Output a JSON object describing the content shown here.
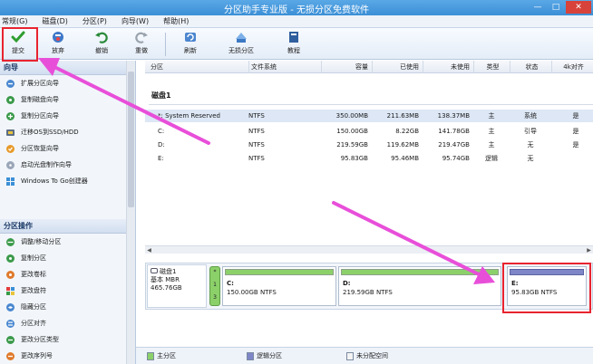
{
  "window": {
    "title": "分区助手专业版 - 无损分区免费软件",
    "controls": [
      "—",
      "□",
      "✕"
    ]
  },
  "menu": [
    "常规(G)",
    "磁盘(D)",
    "分区(P)",
    "向导(W)",
    "帮助(H)"
  ],
  "toolbar": {
    "submit": "提交",
    "discard": "放弃",
    "undo": "撤销",
    "redo": "重做",
    "refresh": "刷新",
    "lossless": "无损分区",
    "tutorial": "教程"
  },
  "left": {
    "wizard_header": "向导",
    "wizard_items": [
      "扩展分区向导",
      "复制磁盘向导",
      "复制分区向导",
      "迁移OS到SSD/HDD",
      "分区恢复向导",
      "启动光盘制作向导",
      "Windows To Go创建器"
    ],
    "ops_header": "分区操作",
    "ops_items": [
      "调整/移动分区",
      "复制分区",
      "更改卷标",
      "更改盘符",
      "隐藏分区",
      "分区对齐",
      "更改分区类型",
      "更改序列号"
    ]
  },
  "table": {
    "headers": [
      "分区",
      "文件系统",
      "容量",
      "已使用",
      "未使用",
      "类型",
      "状态",
      "4k对齐"
    ],
    "disk_title": "磁盘1",
    "rows": [
      {
        "name": "*: System Reserved",
        "fs": "NTFS",
        "cap": "350.00MB",
        "used": "211.63MB",
        "free": "138.37MB",
        "type": "主",
        "status": "系统",
        "align": "是"
      },
      {
        "name": "C:",
        "fs": "NTFS",
        "cap": "150.00GB",
        "used": "8.22GB",
        "free": "141.78GB",
        "type": "主",
        "status": "引导",
        "align": "是"
      },
      {
        "name": "D:",
        "fs": "NTFS",
        "cap": "219.59GB",
        "used": "119.62MB",
        "free": "219.47GB",
        "type": "主",
        "status": "无",
        "align": "是"
      },
      {
        "name": "E:",
        "fs": "NTFS",
        "cap": "95.83GB",
        "used": "95.46MB",
        "free": "95.74GB",
        "type": "逻辑",
        "status": "无",
        "align": ""
      }
    ]
  },
  "diskmap": {
    "disk_name": "磁盘1",
    "disk_type": "基本 MBR",
    "disk_size": "465.76GB",
    "mini_labels": [
      "*",
      "1",
      "3"
    ],
    "partitions": [
      {
        "letter": "C:",
        "info": "150.00GB NTFS"
      },
      {
        "letter": "D:",
        "info": "219.59GB NTFS"
      },
      {
        "letter": "E:",
        "info": "95.83GB NTFS"
      }
    ]
  },
  "legend": {
    "primary": "主分区",
    "logical": "逻辑分区",
    "unallocated": "未分配空间"
  },
  "colors": {
    "primary": "#8cd06a",
    "logical": "#7f86c8",
    "unallocated": "#f4f4f4",
    "annotation": "#e8242f",
    "arrow": "#e84fd9"
  }
}
